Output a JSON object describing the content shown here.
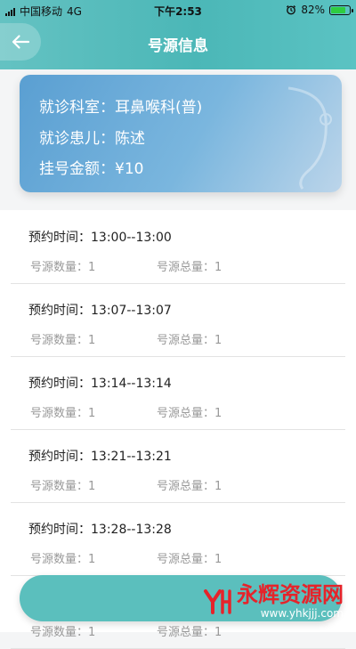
{
  "status_bar": {
    "carrier": "中国移动",
    "network": "4G",
    "time": "下午2:53",
    "battery": "82%",
    "battery_level": 0.82,
    "battery_color": "#2ecc40"
  },
  "nav": {
    "title": "号源信息",
    "back_icon": "arrow-left-icon"
  },
  "summary": {
    "department_label": "就诊科室：",
    "department": "耳鼻喉科(普)",
    "patient_label": "就诊患儿：",
    "patient": "陈述",
    "fee_label": "挂号金额：",
    "fee": "¥10"
  },
  "slots": [
    {
      "time_label": "预约时间：",
      "time": "13:00--13:00",
      "count_label": "号源数量：",
      "count": "1",
      "total_label": "号源总量：",
      "total": "1"
    },
    {
      "time_label": "预约时间：",
      "time": "13:07--13:07",
      "count_label": "号源数量：",
      "count": "1",
      "total_label": "号源总量：",
      "total": "1"
    },
    {
      "time_label": "预约时间：",
      "time": "13:14--13:14",
      "count_label": "号源数量：",
      "count": "1",
      "total_label": "号源总量：",
      "total": "1"
    },
    {
      "time_label": "预约时间：",
      "time": "13:21--13:21",
      "count_label": "号源数量：",
      "count": "1",
      "total_label": "号源总量：",
      "total": "1"
    },
    {
      "time_label": "预约时间：",
      "time": "13:28--13:28",
      "count_label": "号源数量：",
      "count": "1",
      "total_label": "号源总量：",
      "total": "1"
    },
    {
      "time_label": "",
      "time": "",
      "count_label": "号源数量：",
      "count": "1",
      "total_label": "号源总量：",
      "total": "1"
    }
  ],
  "watermark": {
    "text": "永辉资源网",
    "url": "www.yhkjjj.com"
  },
  "colors": {
    "header": "#4bb7b7",
    "card": "#5a9fd2",
    "button": "#5bbfbd",
    "watermark": "#e6232a"
  }
}
